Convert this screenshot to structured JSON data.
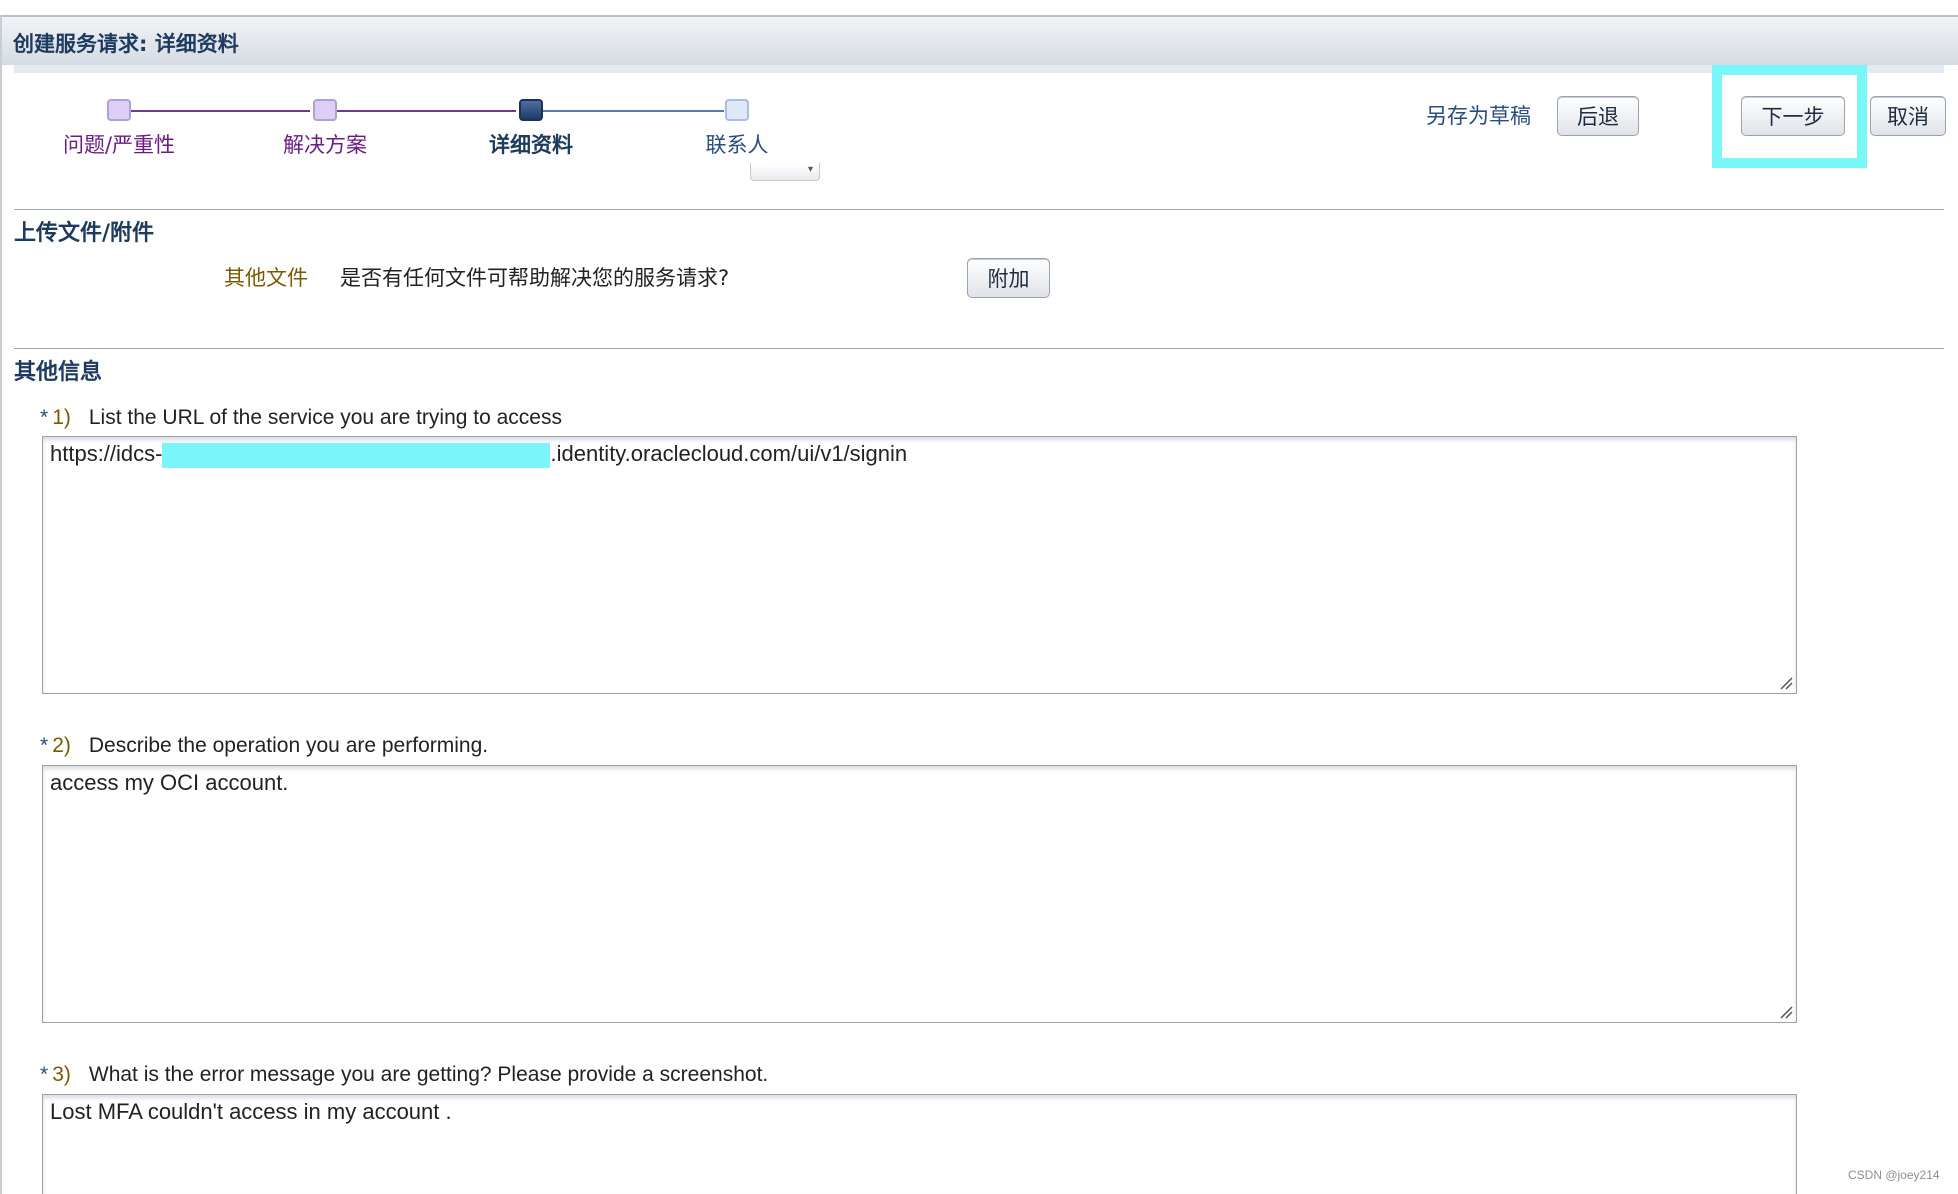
{
  "header": {
    "title": "创建服务请求: 详细资料"
  },
  "train": {
    "steps": [
      {
        "label": "问题/严重性",
        "state": "visited"
      },
      {
        "label": "解决方案",
        "state": "visited"
      },
      {
        "label": "详细资料",
        "state": "current"
      },
      {
        "label": "联系人",
        "state": "upcoming"
      }
    ]
  },
  "toolbar": {
    "save_draft_label": "另存为草稿",
    "back_label": "后退",
    "next_label": "下一步",
    "cancel_label": "取消"
  },
  "upload": {
    "section_title": "上传文件/附件",
    "other_files_label": "其他文件",
    "prompt": "是否有任何文件可帮助解决您的服务请求?",
    "attach_label": "附加"
  },
  "other_info": {
    "section_title": "其他信息",
    "questions": [
      {
        "star": "*",
        "number": "1)",
        "text": "List the URL of the service you are trying to access",
        "answer_prefix": "https://idcs-",
        "answer_suffix": ".identity.oraclecloud.com/ui/v1/signin"
      },
      {
        "star": "*",
        "number": "2)",
        "text": "Describe the operation you are performing.",
        "answer": "access my OCI account."
      },
      {
        "star": "*",
        "number": "3)",
        "text": "What is the error message you are getting? Please provide a screenshot.",
        "answer": "Lost MFA couldn't access in my account ."
      }
    ]
  },
  "watermark": "CSDN @joey214",
  "colors": {
    "accent": "#1d3a5f",
    "visited_step": "#d9c9f0",
    "current_step": "#2d4f80",
    "highlight": "#78f6f8",
    "redaction": "#7af6fa"
  }
}
